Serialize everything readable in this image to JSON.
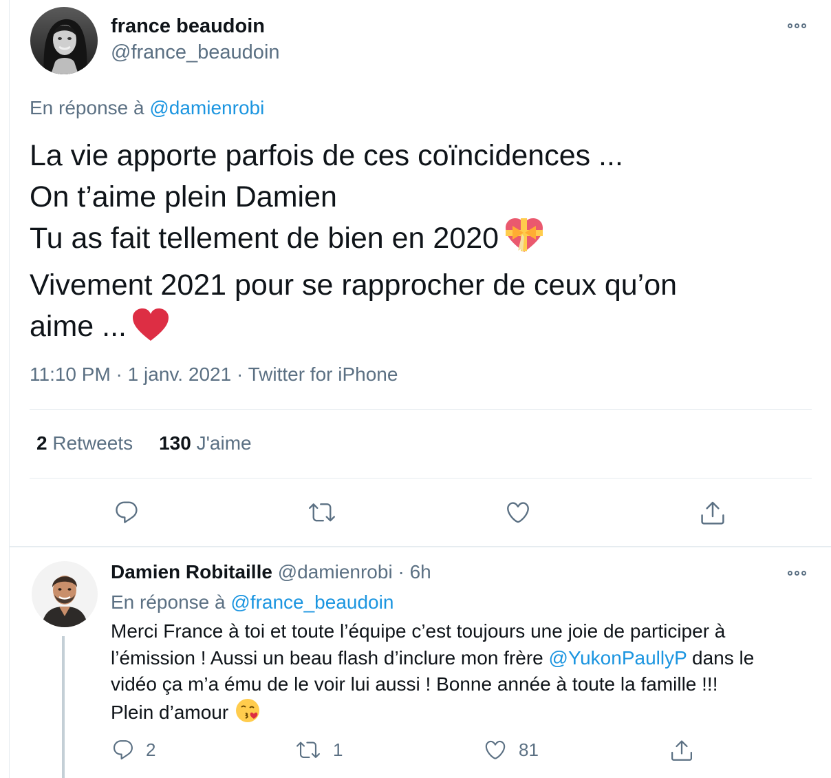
{
  "main_tweet": {
    "author_name": "france beaudoin",
    "author_handle": "@france_beaudoin",
    "reply_prefix": "En réponse à",
    "reply_to": "@damienrobi",
    "text_lines": [
      "La vie apporte parfois de ces coïncidences ...",
      "On t’aime plein Damien",
      "Tu as fait tellement de bien en 2020",
      "Vivement 2021 pour se rapprocher de ceux qu’on",
      "aime ..."
    ],
    "emojis": [
      "heart-with-ribbon-emoji",
      "red-heart-emoji"
    ],
    "time": "11:10 PM",
    "date": "1 janv. 2021",
    "source": "Twitter for iPhone",
    "meta_separator": " · ",
    "retweets_count": "2",
    "retweets_label": "Retweets",
    "likes_count": "130",
    "likes_label": "J'aime"
  },
  "reply_tweet": {
    "author_name": "Damien Robitaille",
    "author_handle": "@damienrobi",
    "separator": " · ",
    "time_ago": "6h",
    "reply_prefix": "En réponse à",
    "reply_to": "@france_beaudoin",
    "text_line1": "Merci France à toi et toute l’équipe c’est toujours une joie de participer à",
    "text_line2_before": "l’émission ! Aussi un beau flash d’inclure mon frère ",
    "text_line2_mention": "@YukonPaullyP",
    "text_line2_after": " dans le",
    "text_line3": "vidéo ça m’a ému de le voir lui aussi ! Bonne année à toute la famille !!!",
    "text_line4": "Plein d’amour",
    "emoji": "face-blowing-kiss-emoji",
    "replies_count": "2",
    "retweets_count": "1",
    "likes_count": "81"
  },
  "colors": {
    "link": "#1b95e0",
    "secondary_text": "#5b7083",
    "primary_text": "#0f1419",
    "divider": "#e6ecf0",
    "heart_red": "#dd2e44"
  }
}
